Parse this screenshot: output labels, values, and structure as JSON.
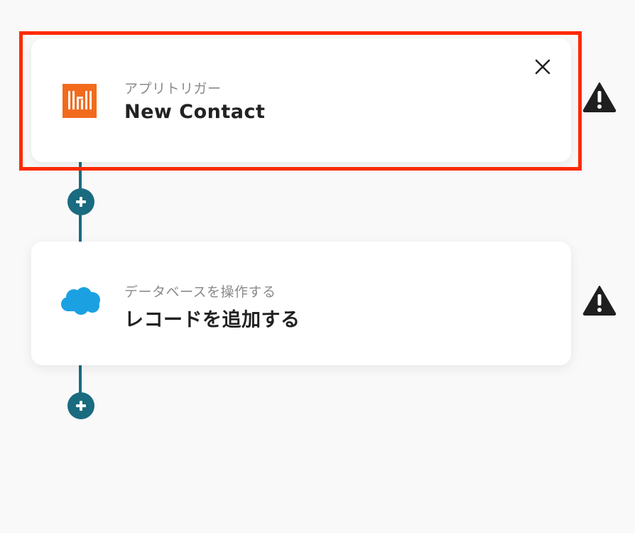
{
  "workflow": {
    "steps": [
      {
        "kind": "trigger",
        "subtitle": "アプリトリガー",
        "title": "New Contact",
        "icon": "hubspot-like-orange-bars-icon",
        "icon_color": "#f26b1d",
        "selected": true
      },
      {
        "kind": "action",
        "subtitle": "データベースを操作する",
        "title": "レコードを追加する",
        "icon": "salesforce-cloud-icon",
        "icon_color": "#1ba1e2"
      }
    ]
  },
  "colors": {
    "connector": "#1a6b80",
    "selection_border": "#ff2a00",
    "background": "#f9f9f9",
    "warning": "#1f1f1f"
  }
}
